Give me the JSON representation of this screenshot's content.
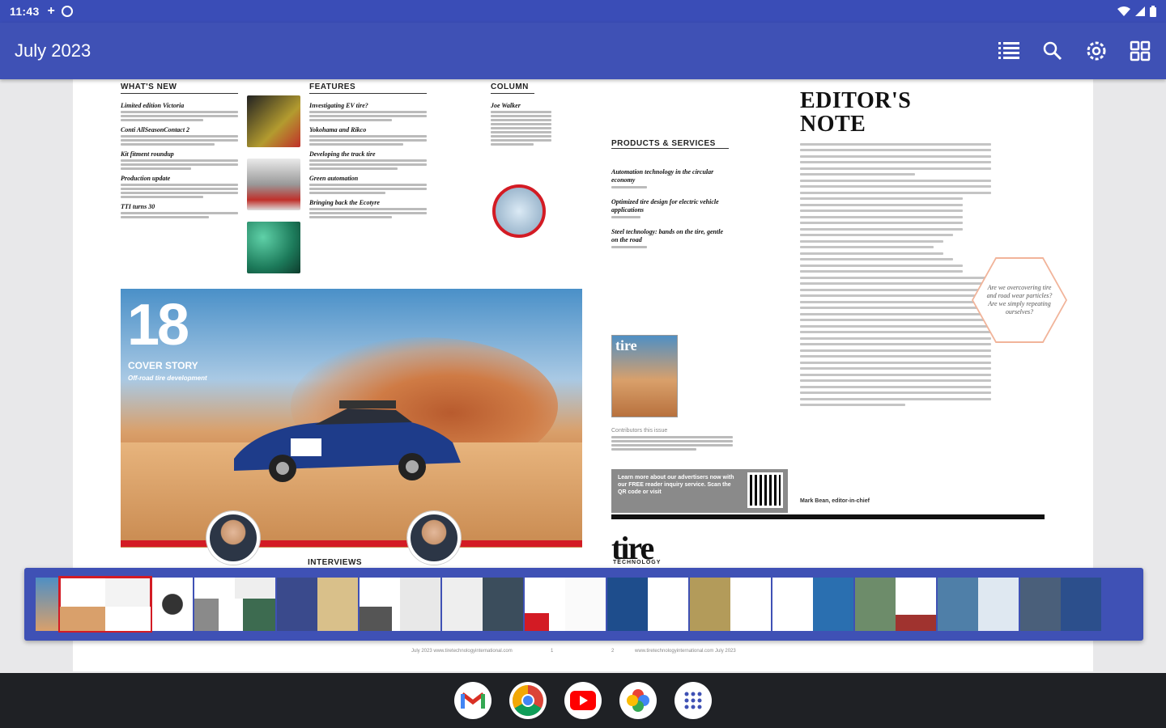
{
  "status_bar": {
    "time": "11:43"
  },
  "app_bar": {
    "title": "July 2023",
    "actions": [
      "contents-list-icon",
      "search-icon",
      "settings-icon",
      "grid-view-icon"
    ]
  },
  "left_page": {
    "whats_new_head": "WHAT'S NEW",
    "features_head": "FEATURES",
    "column_head": "COLUMN",
    "whats_new": [
      "Limited edition Victoria",
      "Conti AllSeasonContact 2",
      "Kit fitment roundup",
      "Production update",
      "TTI turns 30"
    ],
    "features": [
      "Investigating EV tire?",
      "Yokohama and Rikco",
      "Developing the track tire",
      "Green automation",
      "Bringing back the Ecotyre"
    ],
    "column": [
      "Joe Walker"
    ],
    "cover": {
      "number": "18",
      "label": "COVER STORY",
      "sub": "Off-road tire development"
    },
    "interviews": "INTERVIEWS"
  },
  "right_page": {
    "products_head": "PRODUCTS & SERVICES",
    "products": [
      "Automation technology in the circular economy",
      "Optimized tire design for electric vehicle applications",
      "Steel technology: bands on the tire, gentle on the road"
    ],
    "mini_cover_brand": "tire",
    "contributors_title": "Contributors this issue",
    "ad_text": "Learn more about our advertisers now with our FREE reader inquiry service. Scan the QR code or visit",
    "masthead": "tire",
    "masthead_sub": "TECHNOLOGY",
    "editor_title_1": "EDITOR'S",
    "editor_title_2": "NOTE",
    "pull_quote": "Are we overcovering tire and road wear particles? Are we simply repeating ourselves?",
    "signoff": "Mark Bean, editor-in-chief"
  },
  "footer": {
    "left": "July 2023 www.tiretechnologyinternational.com",
    "left_num": "1",
    "right_num": "2",
    "right": "www.tiretechnologyinternational.com July 2023"
  },
  "dock": [
    "gmail-icon",
    "chrome-icon",
    "youtube-icon",
    "photos-icon",
    "app-launcher-icon"
  ],
  "colors": {
    "primary": "#3f51b5",
    "accent_red": "#d31b24",
    "dock_bg": "#1f2125"
  }
}
